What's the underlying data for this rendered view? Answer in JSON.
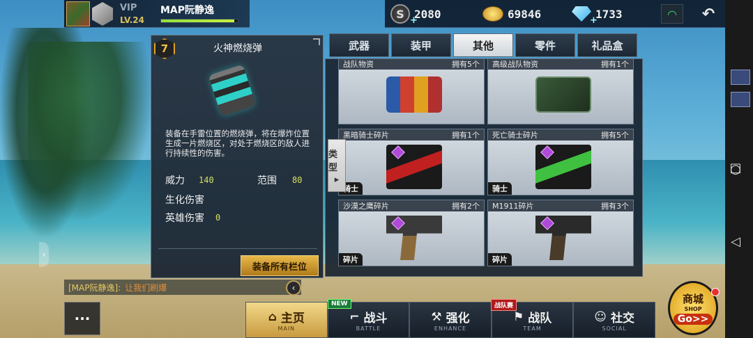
{
  "profile": {
    "vip": "VIP",
    "level": "LV.24",
    "name": "MAP阮静逸",
    "xp_progress": 0.95
  },
  "currency": {
    "s_points": "2080",
    "gold": "69846",
    "diamonds": "1733"
  },
  "item": {
    "level": "7",
    "title": "火神燃烧弹",
    "description": "装备在手雷位置的燃烧弹，将在爆炸位置生成一片燃烧区，对处于燃烧区的敌人进行持续性的伤害。",
    "stats": {
      "power_label": "威力",
      "power_value": "140",
      "range_label": "范围",
      "range_value": "80",
      "bio_label": "生化伤害",
      "hero_label": "英雄伤害",
      "hero_value": "0"
    },
    "equip_button": "装备所有栏位"
  },
  "tabs": [
    "武器",
    "装甲",
    "其他",
    "零件",
    "礼品盒"
  ],
  "active_tab": "其他",
  "type_filter": "类型",
  "shop_items": [
    {
      "name": "战队物资",
      "owned": "拥有5个",
      "tag": ""
    },
    {
      "name": "高级战队物资",
      "owned": "拥有1个",
      "tag": ""
    },
    {
      "name": "黑暗骑士碎片",
      "owned": "拥有1个",
      "tag": "骑士"
    },
    {
      "name": "死亡骑士碎片",
      "owned": "拥有5个",
      "tag": "骑士"
    },
    {
      "name": "沙漠之鹰碎片",
      "owned": "拥有2个",
      "tag": "碎片"
    },
    {
      "name": "M1911碎片",
      "owned": "拥有3个",
      "tag": "碎片"
    }
  ],
  "chat": {
    "name": "[MAP阮静逸]:",
    "message": "让我们刷爆"
  },
  "nav": [
    {
      "label": "主页",
      "sub": "MAIN",
      "badge": ""
    },
    {
      "label": "战斗",
      "sub": "BATTLE",
      "badge": "NEW"
    },
    {
      "label": "强化",
      "sub": "ENHANCE",
      "badge": ""
    },
    {
      "label": "战队",
      "sub": "TEAM",
      "badge": "战队赛"
    },
    {
      "label": "社交",
      "sub": "SOCIAL",
      "badge": ""
    }
  ],
  "shop": {
    "main": "商城",
    "sub": "SHOP",
    "go": "Go>>"
  }
}
